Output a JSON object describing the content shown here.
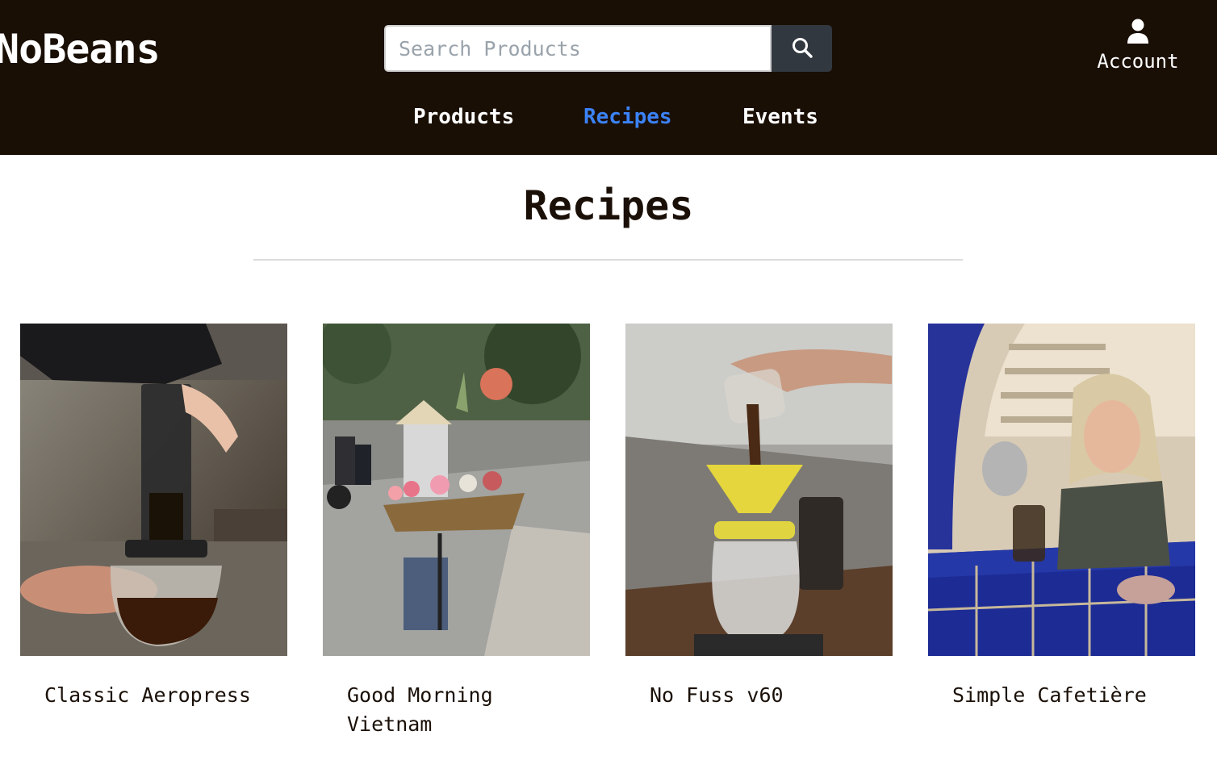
{
  "header": {
    "logo": "NoBeans",
    "search": {
      "placeholder": "Search Products",
      "value": ""
    },
    "search_button_icon": "search-icon",
    "account": {
      "label": "Account",
      "icon": "user-icon"
    }
  },
  "nav": {
    "items": [
      {
        "label": "Products",
        "active": false
      },
      {
        "label": "Recipes",
        "active": true
      },
      {
        "label": "Events",
        "active": false
      }
    ]
  },
  "main": {
    "title": "Recipes",
    "recipes": [
      {
        "title": "Classic Aeropress"
      },
      {
        "title": "Good Morning Vietnam"
      },
      {
        "title": "No Fuss v60"
      },
      {
        "title": "Simple Cafetière"
      }
    ]
  },
  "colors": {
    "header_bg": "#1a0f05",
    "active_nav": "#3b82f6",
    "search_button": "#323840"
  }
}
